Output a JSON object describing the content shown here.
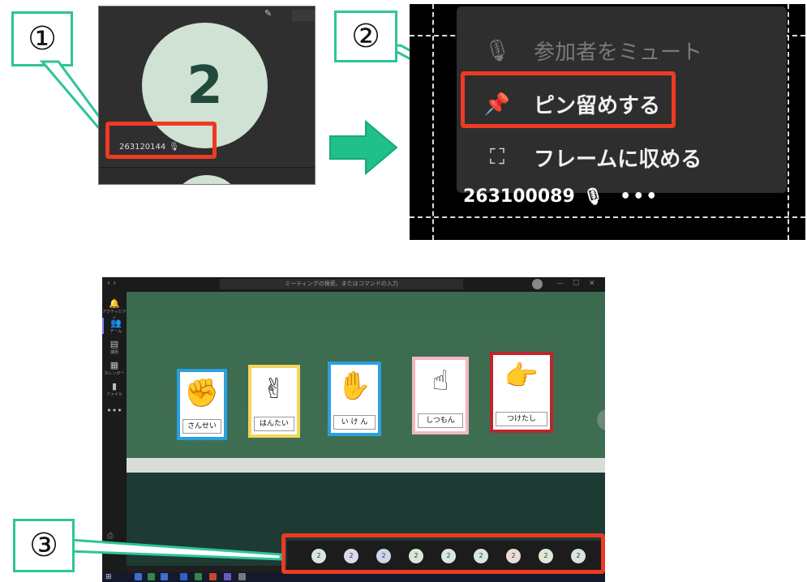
{
  "callouts": {
    "one": "①",
    "two": "②",
    "three": "③"
  },
  "panel1": {
    "big_number": "2",
    "participant_name": "263120144"
  },
  "panel2": {
    "menu_items": [
      {
        "label": "参加者をミュート",
        "icon": "mic-off-icon",
        "state": "disabled"
      },
      {
        "label": "ピン留めする",
        "icon": "pin-icon",
        "state": "highlighted"
      },
      {
        "label": "フレームに収める",
        "icon": "fit-frame-icon",
        "state": "normal"
      }
    ],
    "participant_name": "263100089",
    "more_label": "•••"
  },
  "panel3": {
    "search_placeholder": "ミーティングの検索、またはコマンドの入力",
    "rail": [
      {
        "label": "アクティビティ"
      },
      {
        "label": "チーム"
      },
      {
        "label": "課題"
      },
      {
        "label": "カレンダー"
      },
      {
        "label": "ファイル"
      }
    ],
    "cards": [
      {
        "label": "さんせい",
        "hand": "✊",
        "color": "#2b9fe0"
      },
      {
        "label": "はんたい",
        "hand": "✌",
        "color": "#f2d55c"
      },
      {
        "label": "い け ん",
        "hand": "✋",
        "color": "#2b9fe0"
      },
      {
        "label": "しつもん",
        "hand": "☝",
        "color": "#f4b6c2"
      },
      {
        "label": "つけたし",
        "hand": "👉",
        "color": "#c0242b"
      }
    ],
    "participant_avatar_label": "2",
    "participant_avatar_colors": [
      "#d8e7dc",
      "#e1d8ec",
      "#cfd6ec",
      "#d9e6d9",
      "#d7e8dd",
      "#d7e8dd",
      "#ecdcd8",
      "#dde8d5",
      "#d8e3dc"
    ]
  }
}
